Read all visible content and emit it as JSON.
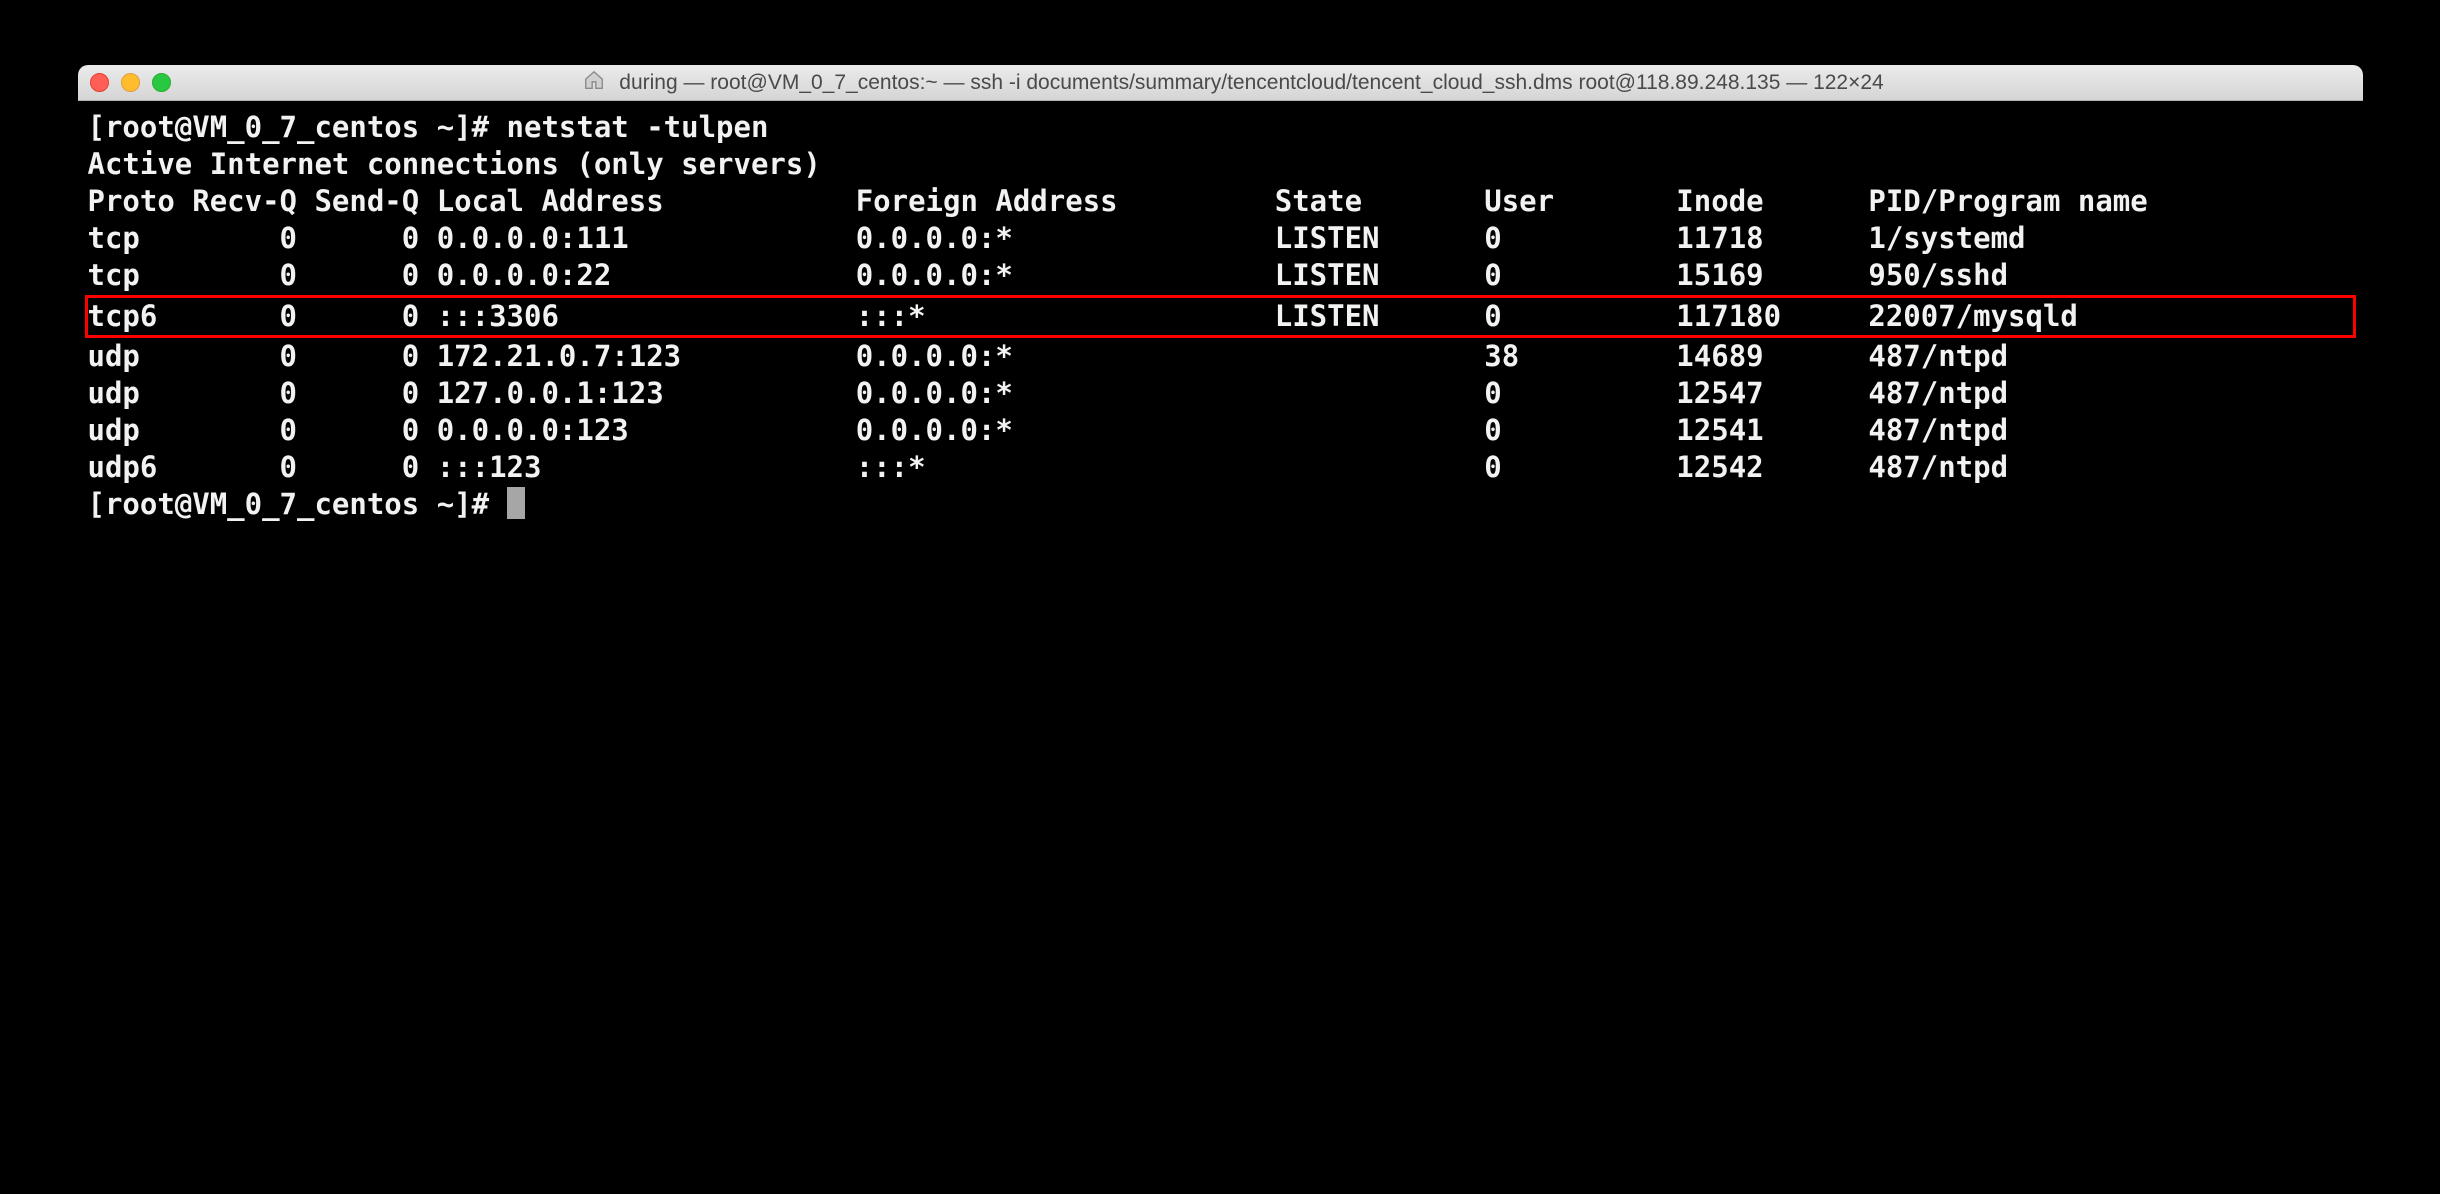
{
  "window": {
    "title": "during — root@VM_0_7_centos:~ — ssh -i documents/summary/tencentcloud/tencent_cloud_ssh.dms root@118.89.248.135 — 122×24"
  },
  "terminal": {
    "prompt1": "[root@VM_0_7_centos ~]# ",
    "command1": "netstat -tulpen",
    "header_line": "Active Internet connections (only servers)",
    "columns": "Proto Recv-Q Send-Q Local Address           Foreign Address         State       User       Inode      PID/Program name    ",
    "rows": [
      "tcp        0      0 0.0.0.0:111             0.0.0.0:*               LISTEN      0          11718      1/systemd           ",
      "tcp        0      0 0.0.0.0:22              0.0.0.0:*               LISTEN      0          15169      950/sshd            ",
      "tcp6       0      0 :::3306                 :::*                    LISTEN      0          117180     22007/mysqld        ",
      "udp        0      0 172.21.0.7:123          0.0.0.0:*                           38         14689      487/ntpd            ",
      "udp        0      0 127.0.0.1:123           0.0.0.0:*                           0          12547      487/ntpd            ",
      "udp        0      0 0.0.0.0:123             0.0.0.0:*                           0          12541      487/ntpd            ",
      "udp6       0      0 :::123                  :::*                                0          12542      487/ntpd            "
    ],
    "highlighted_index": 2,
    "prompt2": "[root@VM_0_7_centos ~]# "
  }
}
